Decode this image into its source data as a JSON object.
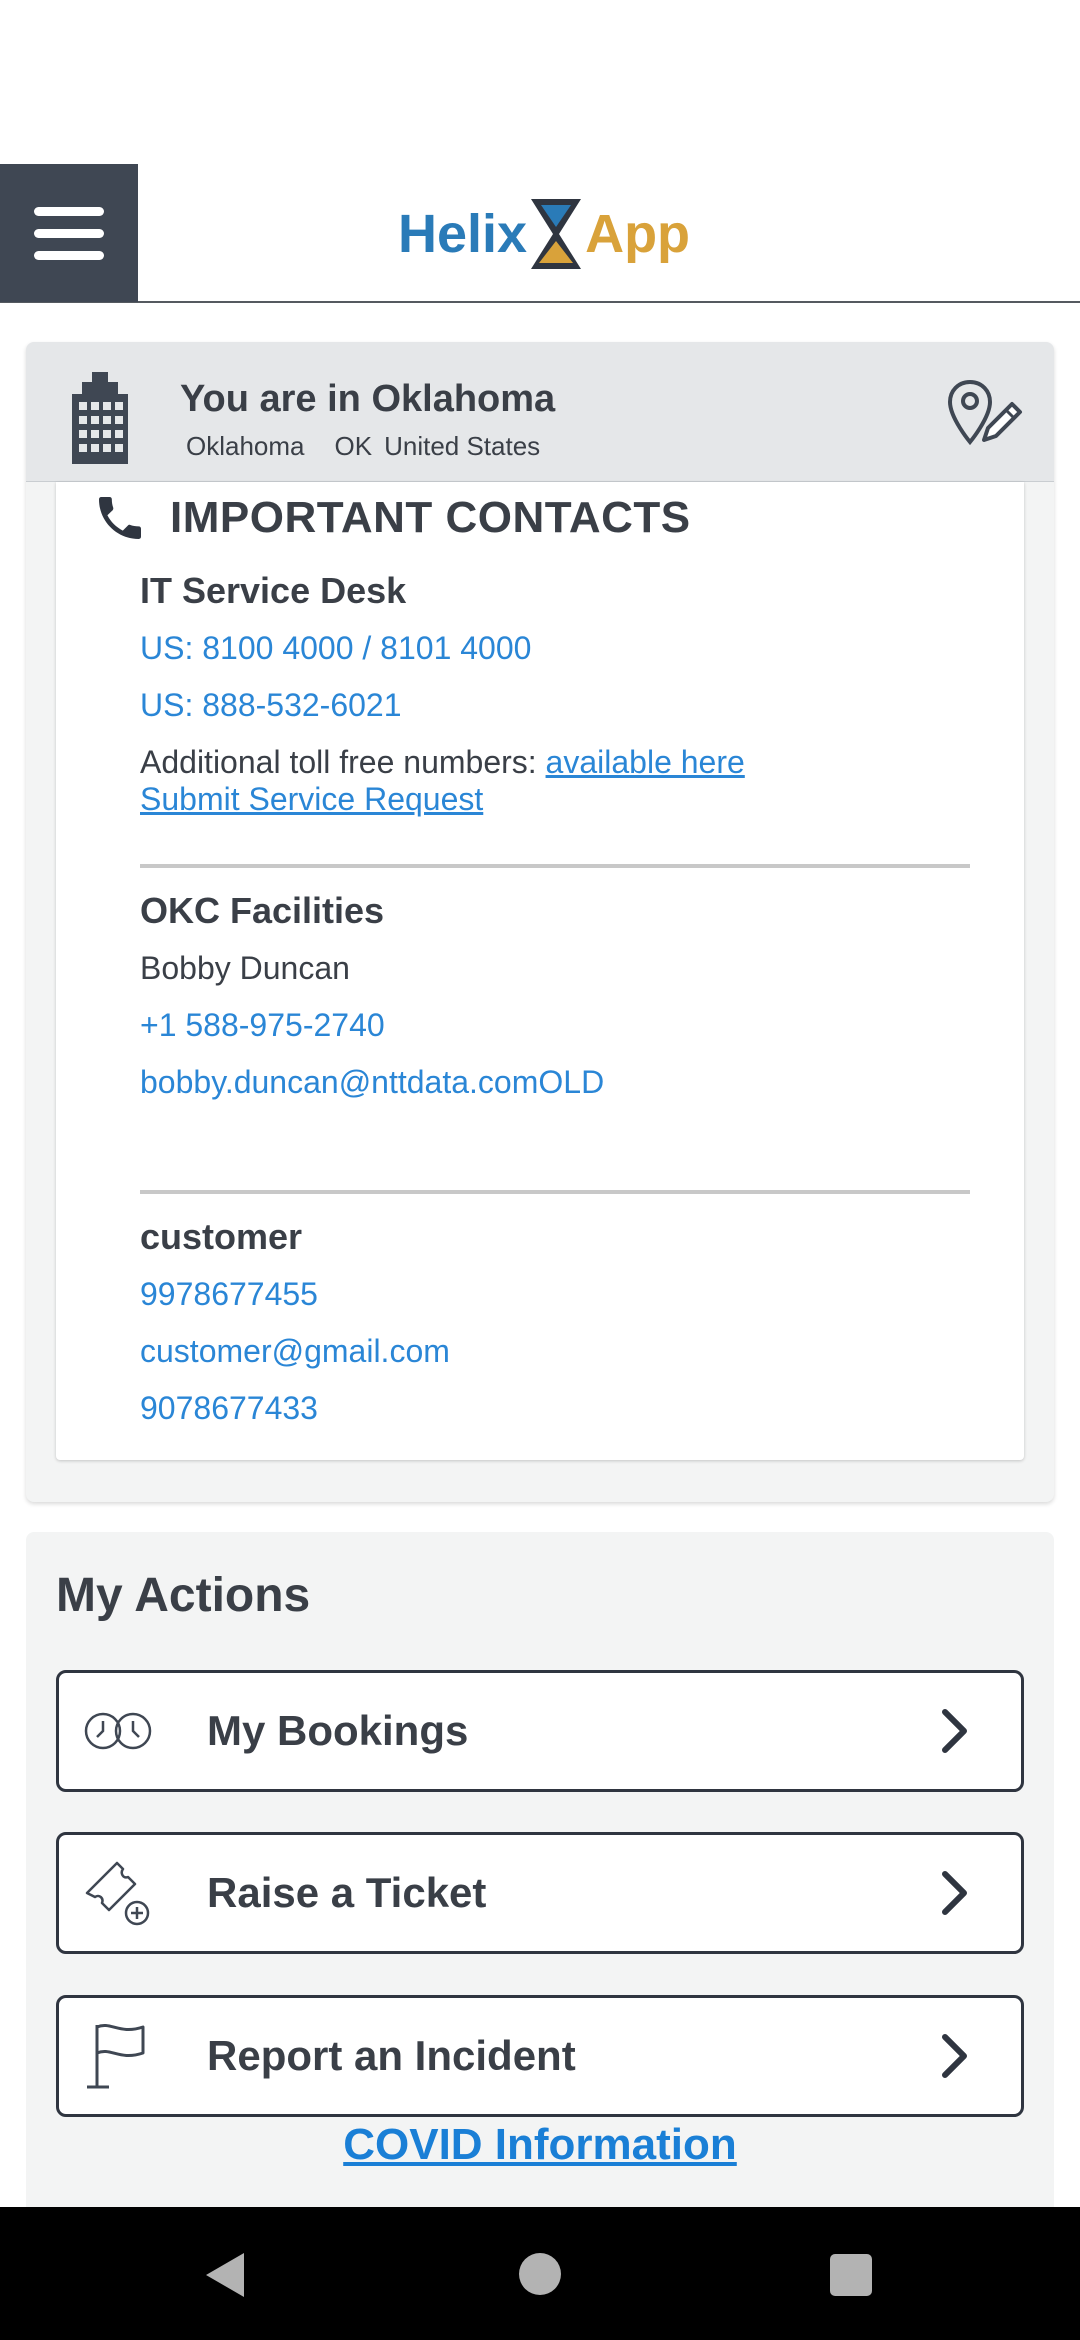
{
  "header": {
    "logo_left": "Helix",
    "logo_right": "App"
  },
  "location": {
    "title": "You are in Oklahoma",
    "city": "Oklahoma",
    "state": "OK",
    "country": "United States"
  },
  "contacts": {
    "heading": "IMPORTANT CONTACTS",
    "it_desk": {
      "title": "IT Service Desk",
      "phone1": "US: 8100 4000 / 8101 4000",
      "phone2": "US: 888-532-6021",
      "tollfree_prefix": "Additional toll free numbers: ",
      "tollfree_link": "available here",
      "request_link": "Submit Service Request"
    },
    "facilities": {
      "title": "OKC Facilities",
      "name": "Bobby Duncan",
      "phone": "+1 588-975-2740",
      "email": "bobby.duncan@nttdata.comOLD"
    },
    "customer": {
      "title": "customer",
      "phone1": "9978677455",
      "email": "customer@gmail.com",
      "phone2": "9078677433"
    }
  },
  "actions": {
    "title": "My Actions",
    "items": [
      {
        "label": "My Bookings",
        "icon": "clocks-icon"
      },
      {
        "label": "Raise a Ticket",
        "icon": "ticket-add-icon"
      },
      {
        "label": "Report an Incident",
        "icon": "flag-icon"
      }
    ],
    "covid_link": "COVID Information"
  },
  "colors": {
    "link": "#2a86d6",
    "header_menu_bg": "#3f4753",
    "logo_blue": "#2a7bb8",
    "logo_gold": "#d9a23a"
  }
}
